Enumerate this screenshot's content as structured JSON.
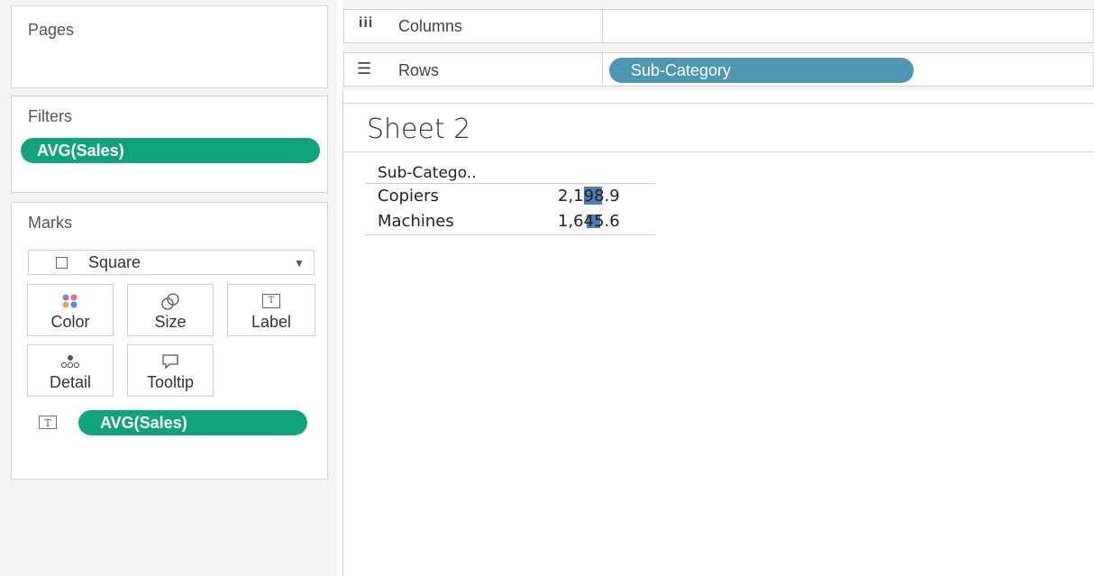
{
  "panels": {
    "pages": {
      "title": "Pages"
    },
    "filters": {
      "title": "Filters",
      "pills": [
        "AVG(Sales)"
      ]
    },
    "marks": {
      "title": "Marks",
      "mark_type": "Square",
      "buttons": {
        "color": "Color",
        "size": "Size",
        "label": "Label",
        "detail": "Detail",
        "tooltip": "Tooltip"
      },
      "fields": [
        {
          "icon": "T",
          "name": "AVG(Sales)"
        }
      ]
    }
  },
  "shelves": {
    "columns": {
      "label": "Columns",
      "pills": []
    },
    "rows": {
      "label": "Rows",
      "pills": [
        "Sub-Category"
      ]
    }
  },
  "sheet": {
    "title": "Sheet 2",
    "table": {
      "header": "Sub-Catego..",
      "rows": [
        {
          "label": "Copiers",
          "value": "2,198.9",
          "bar_fraction": 1.0
        },
        {
          "label": "Machines",
          "value": "1,645.6",
          "bar_fraction": 0.75
        }
      ]
    }
  },
  "colors": {
    "pill_green": "#12a37a",
    "pill_blue": "#4d97b3",
    "mark_square": "#3f6fae"
  }
}
